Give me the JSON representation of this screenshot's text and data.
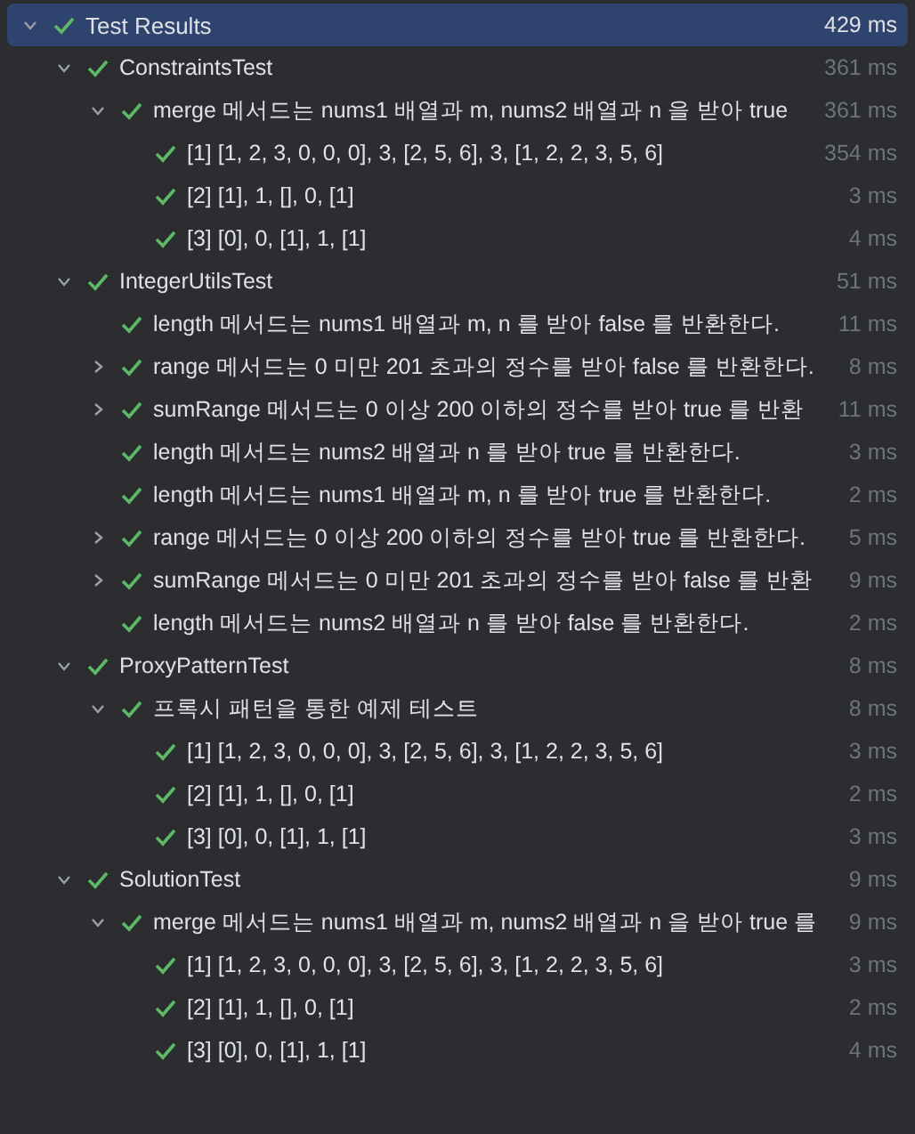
{
  "tree": [
    {
      "label": "Test Results",
      "time": "429 ms",
      "passed": true,
      "kind": "group",
      "expanded": true,
      "selected": true,
      "children": [
        {
          "label": "ConstraintsTest",
          "time": "361 ms",
          "passed": true,
          "kind": "group",
          "expanded": true,
          "selected": false,
          "children": [
            {
              "label": "merge 메서드는 nums1 배열과 m, nums2 배열과 n 을 받아 true",
              "time": "361 ms",
              "passed": true,
              "kind": "group",
              "expanded": true,
              "selected": false,
              "children": [
                {
                  "label": "[1] [1, 2, 3, 0, 0, 0], 3, [2, 5, 6], 3, [1, 2, 2, 3, 5, 6]",
                  "time": "354 ms",
                  "passed": true,
                  "kind": "test",
                  "selected": false
                },
                {
                  "label": "[2] [1], 1, [], 0, [1]",
                  "time": "3 ms",
                  "passed": true,
                  "kind": "test",
                  "selected": false
                },
                {
                  "label": "[3] [0], 0, [1], 1, [1]",
                  "time": "4 ms",
                  "passed": true,
                  "kind": "test",
                  "selected": false
                }
              ]
            }
          ]
        },
        {
          "label": "IntegerUtilsTest",
          "time": "51 ms",
          "passed": true,
          "kind": "group",
          "expanded": true,
          "selected": false,
          "children": [
            {
              "label": "length 메서드는 nums1 배열과 m, n 를 받아 false 를 반환한다.",
              "time": "11 ms",
              "passed": true,
              "kind": "test",
              "selected": false
            },
            {
              "label": "range 메서드는 0 미만 201 초과의 정수를 받아 false 를 반환한다.",
              "time": "8 ms",
              "passed": true,
              "kind": "group",
              "expanded": false,
              "selected": false
            },
            {
              "label": "sumRange 메서드는 0 이상 200 이하의 정수를 받아 true 를 반환",
              "time": "11 ms",
              "passed": true,
              "kind": "group",
              "expanded": false,
              "selected": false
            },
            {
              "label": "length 메서드는 nums2 배열과 n 를 받아 true 를 반환한다.",
              "time": "3 ms",
              "passed": true,
              "kind": "test",
              "selected": false
            },
            {
              "label": "length 메서드는 nums1 배열과 m, n 를 받아 true 를 반환한다.",
              "time": "2 ms",
              "passed": true,
              "kind": "test",
              "selected": false
            },
            {
              "label": "range 메서드는 0 이상 200 이하의 정수를 받아 true 를 반환한다.",
              "time": "5 ms",
              "passed": true,
              "kind": "group",
              "expanded": false,
              "selected": false
            },
            {
              "label": "sumRange 메서드는 0 미만 201 초과의 정수를 받아 false 를 반환",
              "time": "9 ms",
              "passed": true,
              "kind": "group",
              "expanded": false,
              "selected": false
            },
            {
              "label": "length 메서드는 nums2 배열과 n 를 받아 false 를 반환한다.",
              "time": "2 ms",
              "passed": true,
              "kind": "test",
              "selected": false
            }
          ]
        },
        {
          "label": "ProxyPatternTest",
          "time": "8 ms",
          "passed": true,
          "kind": "group",
          "expanded": true,
          "selected": false,
          "children": [
            {
              "label": "프록시 패턴을 통한 예제 테스트",
              "time": "8 ms",
              "passed": true,
              "kind": "group",
              "expanded": true,
              "selected": false,
              "children": [
                {
                  "label": "[1] [1, 2, 3, 0, 0, 0], 3, [2, 5, 6], 3, [1, 2, 2, 3, 5, 6]",
                  "time": "3 ms",
                  "passed": true,
                  "kind": "test",
                  "selected": false
                },
                {
                  "label": "[2] [1], 1, [], 0, [1]",
                  "time": "2 ms",
                  "passed": true,
                  "kind": "test",
                  "selected": false
                },
                {
                  "label": "[3] [0], 0, [1], 1, [1]",
                  "time": "3 ms",
                  "passed": true,
                  "kind": "test",
                  "selected": false
                }
              ]
            }
          ]
        },
        {
          "label": "SolutionTest",
          "time": "9 ms",
          "passed": true,
          "kind": "group",
          "expanded": true,
          "selected": false,
          "children": [
            {
              "label": "merge 메서드는 nums1 배열과 m, nums2 배열과 n 을 받아 true 를",
              "time": "9 ms",
              "passed": true,
              "kind": "group",
              "expanded": true,
              "selected": false,
              "children": [
                {
                  "label": "[1] [1, 2, 3, 0, 0, 0], 3, [2, 5, 6], 3, [1, 2, 2, 3, 5, 6]",
                  "time": "3 ms",
                  "passed": true,
                  "kind": "test",
                  "selected": false
                },
                {
                  "label": "[2] [1], 1, [], 0, [1]",
                  "time": "2 ms",
                  "passed": true,
                  "kind": "test",
                  "selected": false
                },
                {
                  "label": "[3] [0], 0, [1], 1, [1]",
                  "time": "4 ms",
                  "passed": true,
                  "kind": "test",
                  "selected": false
                }
              ]
            }
          ]
        }
      ]
    }
  ]
}
